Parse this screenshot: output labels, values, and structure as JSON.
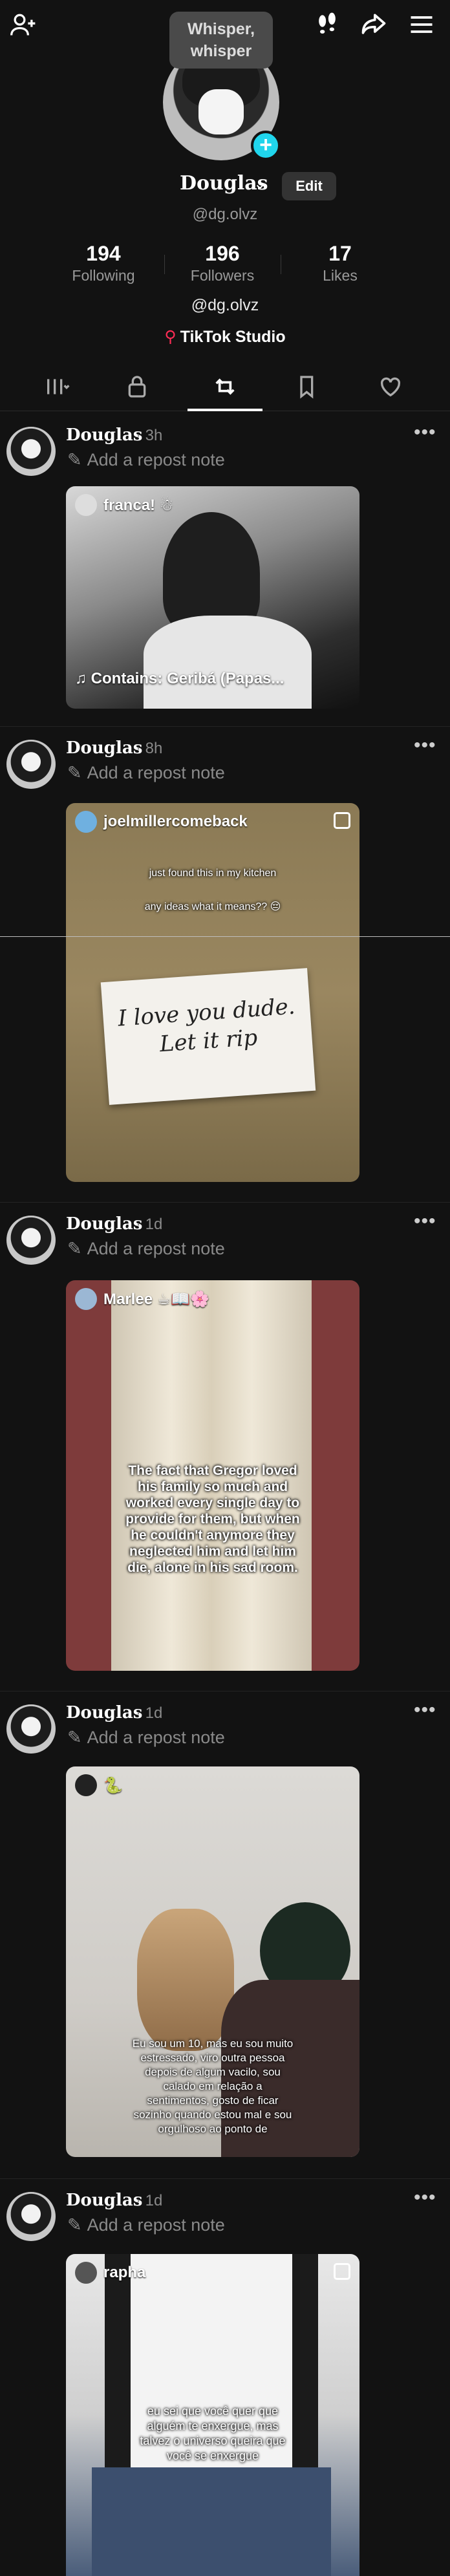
{
  "whisper_tooltip": "Whisper, whisper",
  "profile": {
    "display_name": "Douglas",
    "edit_label": "Edit",
    "username": "@dg.olvz",
    "stats": [
      {
        "value": "194",
        "label": "Following"
      },
      {
        "value": "196",
        "label": "Followers"
      },
      {
        "value": "17",
        "label": "Likes"
      }
    ],
    "bio": "@dg.olvz",
    "studio_label": "TikTok Studio"
  },
  "tabs": [
    "videos-grid",
    "private-lock",
    "reposts",
    "favorites",
    "liked"
  ],
  "posts": [
    {
      "name": "Douglas",
      "time": "· 3h",
      "note": "Add a repost note",
      "author": "franca! ☃",
      "caption": "",
      "music": "♫ Contains: Geribá (Papas..."
    },
    {
      "name": "Douglas",
      "time": "· 8h",
      "note": "Add a repost note",
      "author": "joelmillercomeback",
      "caption": "just found this in my kitchen",
      "caption2": "any ideas what it means?? 😔",
      "note_text": "I love you dude. Let it rip"
    },
    {
      "name": "Douglas",
      "time": "· 1d",
      "note": "Add a repost note",
      "author": "Marlee ☕📖🌸",
      "caption": "The fact that Gregor loved his family so much and worked every single day to provide for them, but when he couldn't anymore they neglected him and let him die, alone in his sad room."
    },
    {
      "name": "Douglas",
      "time": "· 1d",
      "note": "Add a repost note",
      "author": "🐍",
      "caption": "Eu sou um 10, mas eu sou muito estressado, viro outra pessoa depois de algum vacilo, sou calado em relação a sentimentos, gosto de ficar sozinho quando estou mal e sou orgulhoso ao ponto de"
    },
    {
      "name": "Douglas",
      "time": "· 1d",
      "note": "Add a repost note",
      "author": "rapha",
      "caption": "eu sei que você quer que alguém te enxergue, mas talvez o universo queira que você se enxergue"
    }
  ],
  "colors": {
    "accent": "#20d5ec",
    "studio": "#fe2c55",
    "background": "#121212"
  }
}
